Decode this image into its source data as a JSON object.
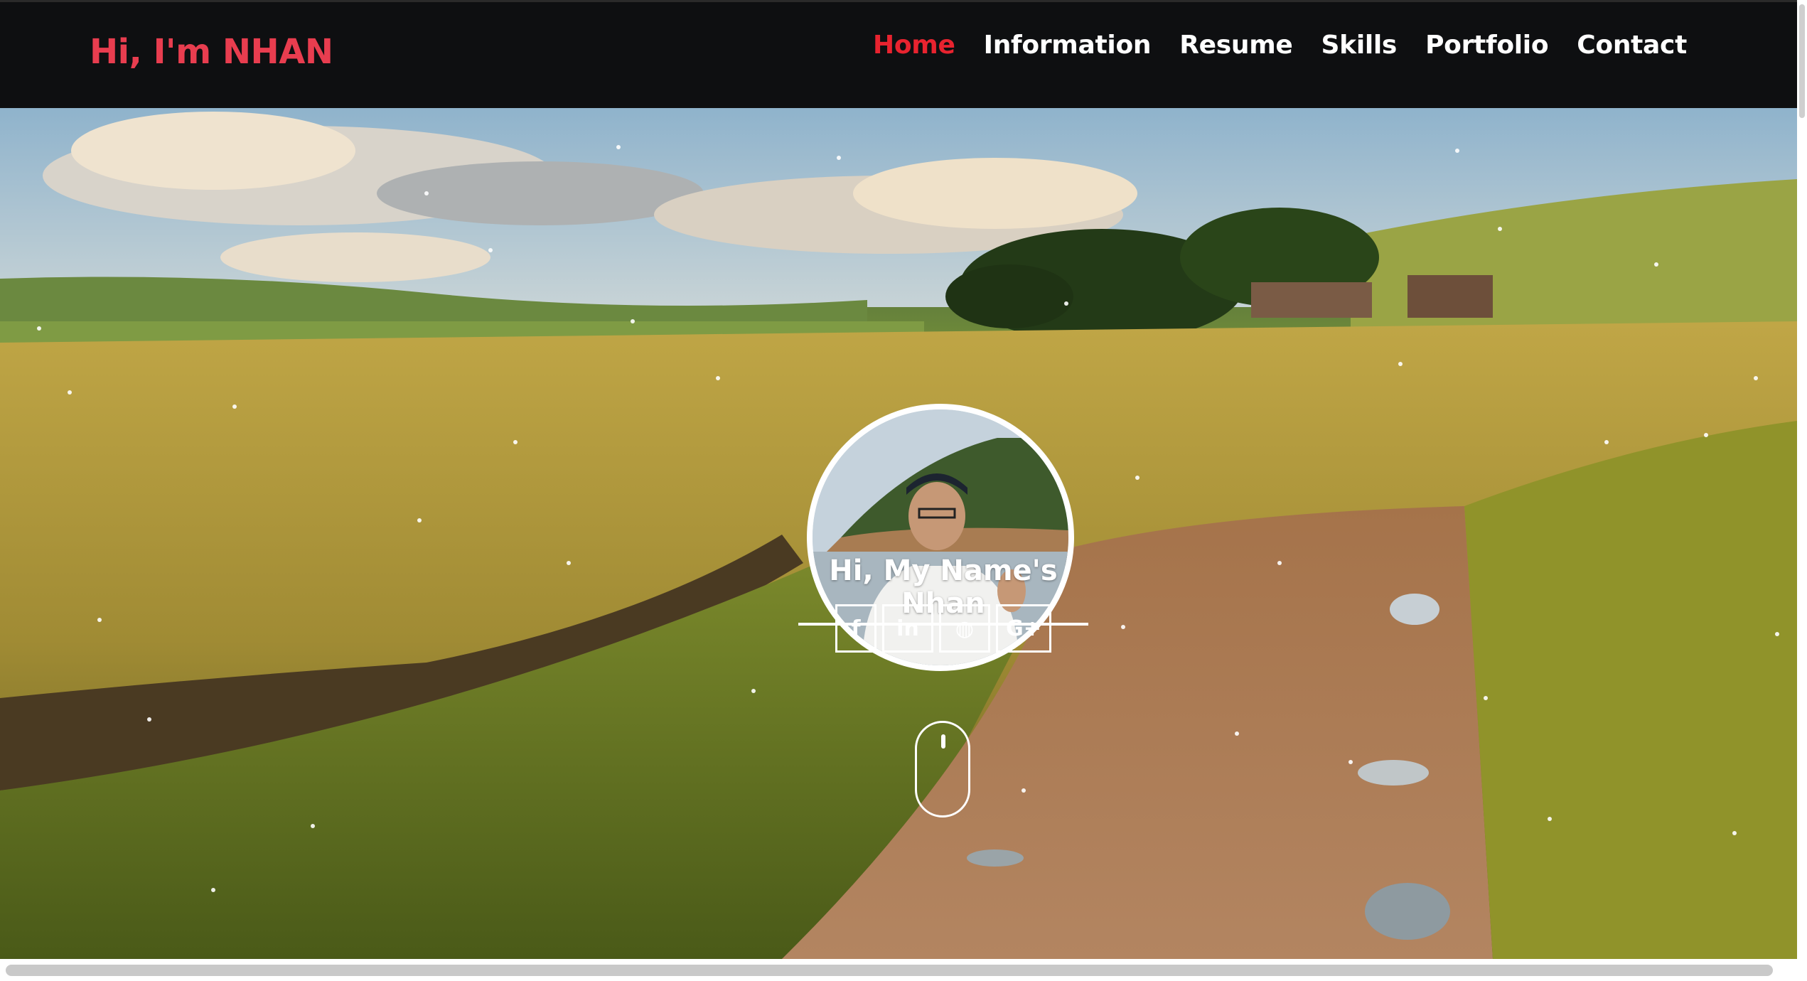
{
  "navbar": {
    "brand": "Hi, I'm NHAN",
    "items": [
      {
        "label": "Home",
        "active": true
      },
      {
        "label": "Information",
        "active": false
      },
      {
        "label": "Resume",
        "active": false
      },
      {
        "label": "Skills",
        "active": false
      },
      {
        "label": "Portfolio",
        "active": false
      },
      {
        "label": "Contact",
        "active": false
      }
    ]
  },
  "hero": {
    "heading": "Hi, My Name's Nhan",
    "socials": [
      {
        "icon": "facebook-icon",
        "glyph": "f"
      },
      {
        "icon": "linkedin-icon",
        "glyph": "in"
      },
      {
        "icon": "github-icon",
        "glyph": "◍"
      },
      {
        "icon": "google-plus-icon",
        "glyph": "G+"
      }
    ],
    "scroll_indicator_icon": "mouse-scroll-icon"
  },
  "colors": {
    "brand": "#e83d4f",
    "active_nav": "#e8232f",
    "navbar_bg": "#0e0f11",
    "text_light": "#ffffff"
  }
}
